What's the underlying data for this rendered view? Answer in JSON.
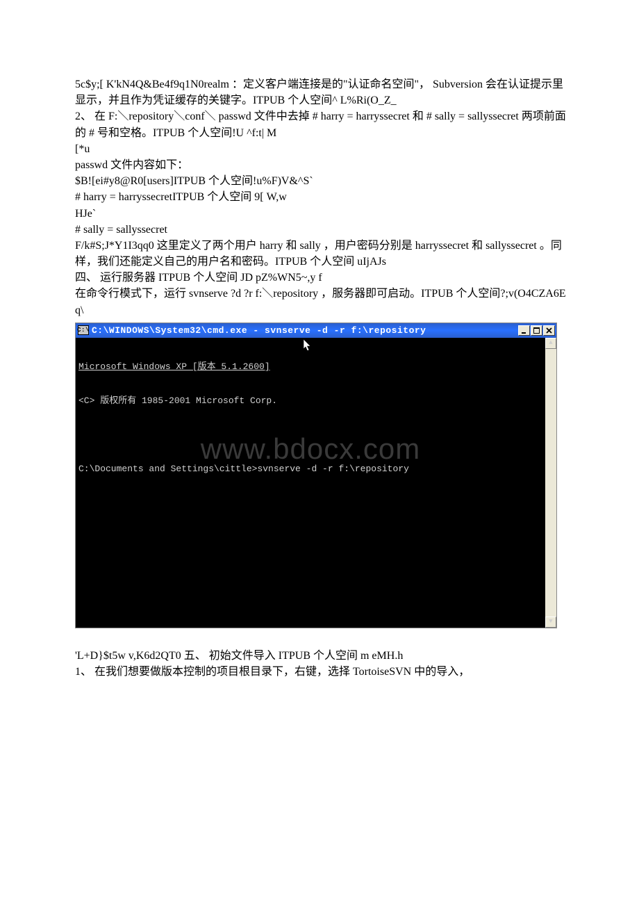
{
  "doc": {
    "p1": "5c$y;[ K'kN4Q&Be4f9q1N0realm ：定义客户端连接是的\"认证命名空间\"， Subversion 会在认证提示里显示，并且作为凭证缓存的关键字。ITPUB 个人空间^ L%Ri(O_Z_",
    "p2": "2、 在 F:＼repository＼conf＼ passwd 文件中去掉 # harry = harryssecret 和 # sally = sallyssecret 两项前面的 # 号和空格。ITPUB 个人空间!U ^f:t| M",
    "p3": "[*u",
    "p4": "passwd 文件内容如下：",
    "p5": "$B![ei#y8@R0[users]ITPUB 个人空间!u%F)V&^S`",
    "p6": "# harry = harryssecretITPUB 个人空间 9[ W,w",
    "p7": "HJe`",
    "p8": "# sally = sallyssecret",
    "p9": "F/k#S;J*Y1I3qq0 这里定义了两个用户 harry 和 sally ，用户密码分别是 harryssecret 和 sallyssecret 。同样，我们还能定义自己的用户名和密码。ITPUB 个人空间 uIjAJs",
    "p10": "四、 运行服务器 ITPUB 个人空间 JD pZ%WN5~,y f",
    "p11": "在命令行模式下，运行 svnserve ?d ?r f:＼repository ，服务器即可启动。ITPUB 个人空间?;v(O4CZA6Eq\\",
    "p12": "'L+D}$t5w v,K6d2QT0 五、 初始文件导入 ITPUB 个人空间 m eMH.h",
    "p13": "1、 在我们想要做版本控制的项目根目录下，右键，选择 TortoiseSVN 中的导入，"
  },
  "cmd": {
    "icon_label": "C:\\",
    "title": "C:\\WINDOWS\\System32\\cmd.exe - svnserve -d -r f:\\repository",
    "line1": "Microsoft Windows XP [版本 5.1.2600]",
    "line2": "<C> 版权所有 1985-2001 Microsoft Corp.",
    "line3": "C:\\Documents and Settings\\cittle>svnserve -d -r f:\\repository",
    "watermark": "www.bdocx.com"
  }
}
